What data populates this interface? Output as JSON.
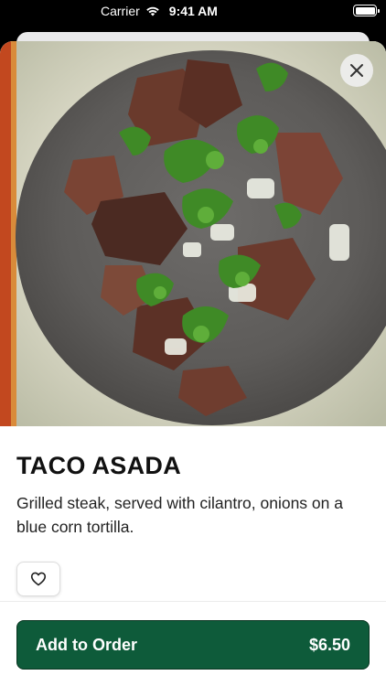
{
  "status_bar": {
    "carrier": "Carrier",
    "time": "9:41 AM"
  },
  "item": {
    "title": "TACO ASADA",
    "description": "Grilled steak, served with cilantro, onions on a blue corn tortilla.",
    "image_icon": "taco-photo"
  },
  "actions": {
    "add_label": "Add to Order",
    "price": "$6.50",
    "favorite_icon": "heart-outline-icon",
    "close_icon": "close-icon"
  },
  "colors": {
    "accent": "#0e5b3a",
    "text": "#111111"
  }
}
